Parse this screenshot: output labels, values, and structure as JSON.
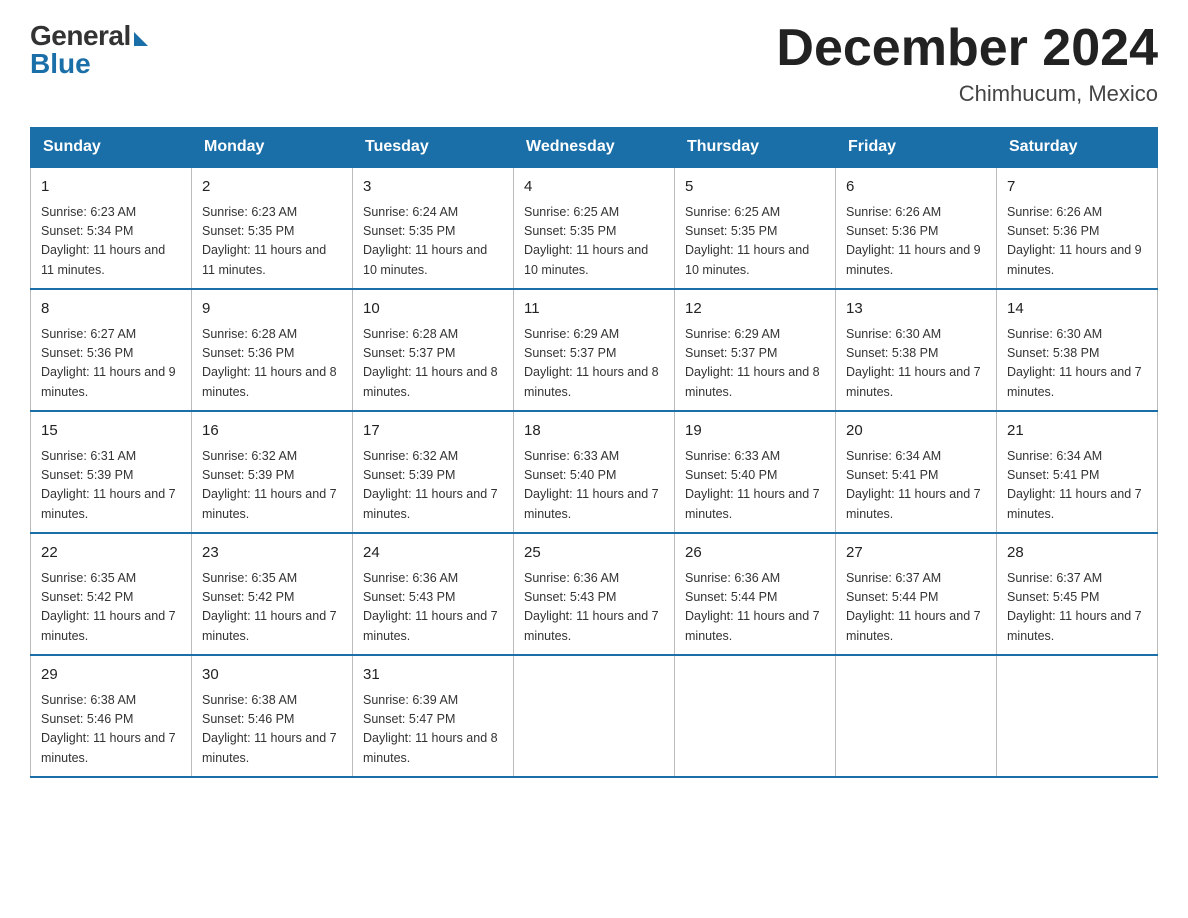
{
  "logo": {
    "general": "General",
    "blue": "Blue"
  },
  "title": {
    "month_year": "December 2024",
    "location": "Chimhucum, Mexico"
  },
  "calendar": {
    "headers": [
      "Sunday",
      "Monday",
      "Tuesday",
      "Wednesday",
      "Thursday",
      "Friday",
      "Saturday"
    ],
    "weeks": [
      [
        {
          "day": "1",
          "sunrise": "6:23 AM",
          "sunset": "5:34 PM",
          "daylight": "11 hours and 11 minutes."
        },
        {
          "day": "2",
          "sunrise": "6:23 AM",
          "sunset": "5:35 PM",
          "daylight": "11 hours and 11 minutes."
        },
        {
          "day": "3",
          "sunrise": "6:24 AM",
          "sunset": "5:35 PM",
          "daylight": "11 hours and 10 minutes."
        },
        {
          "day": "4",
          "sunrise": "6:25 AM",
          "sunset": "5:35 PM",
          "daylight": "11 hours and 10 minutes."
        },
        {
          "day": "5",
          "sunrise": "6:25 AM",
          "sunset": "5:35 PM",
          "daylight": "11 hours and 10 minutes."
        },
        {
          "day": "6",
          "sunrise": "6:26 AM",
          "sunset": "5:36 PM",
          "daylight": "11 hours and 9 minutes."
        },
        {
          "day": "7",
          "sunrise": "6:26 AM",
          "sunset": "5:36 PM",
          "daylight": "11 hours and 9 minutes."
        }
      ],
      [
        {
          "day": "8",
          "sunrise": "6:27 AM",
          "sunset": "5:36 PM",
          "daylight": "11 hours and 9 minutes."
        },
        {
          "day": "9",
          "sunrise": "6:28 AM",
          "sunset": "5:36 PM",
          "daylight": "11 hours and 8 minutes."
        },
        {
          "day": "10",
          "sunrise": "6:28 AM",
          "sunset": "5:37 PM",
          "daylight": "11 hours and 8 minutes."
        },
        {
          "day": "11",
          "sunrise": "6:29 AM",
          "sunset": "5:37 PM",
          "daylight": "11 hours and 8 minutes."
        },
        {
          "day": "12",
          "sunrise": "6:29 AM",
          "sunset": "5:37 PM",
          "daylight": "11 hours and 8 minutes."
        },
        {
          "day": "13",
          "sunrise": "6:30 AM",
          "sunset": "5:38 PM",
          "daylight": "11 hours and 7 minutes."
        },
        {
          "day": "14",
          "sunrise": "6:30 AM",
          "sunset": "5:38 PM",
          "daylight": "11 hours and 7 minutes."
        }
      ],
      [
        {
          "day": "15",
          "sunrise": "6:31 AM",
          "sunset": "5:39 PM",
          "daylight": "11 hours and 7 minutes."
        },
        {
          "day": "16",
          "sunrise": "6:32 AM",
          "sunset": "5:39 PM",
          "daylight": "11 hours and 7 minutes."
        },
        {
          "day": "17",
          "sunrise": "6:32 AM",
          "sunset": "5:39 PM",
          "daylight": "11 hours and 7 minutes."
        },
        {
          "day": "18",
          "sunrise": "6:33 AM",
          "sunset": "5:40 PM",
          "daylight": "11 hours and 7 minutes."
        },
        {
          "day": "19",
          "sunrise": "6:33 AM",
          "sunset": "5:40 PM",
          "daylight": "11 hours and 7 minutes."
        },
        {
          "day": "20",
          "sunrise": "6:34 AM",
          "sunset": "5:41 PM",
          "daylight": "11 hours and 7 minutes."
        },
        {
          "day": "21",
          "sunrise": "6:34 AM",
          "sunset": "5:41 PM",
          "daylight": "11 hours and 7 minutes."
        }
      ],
      [
        {
          "day": "22",
          "sunrise": "6:35 AM",
          "sunset": "5:42 PM",
          "daylight": "11 hours and 7 minutes."
        },
        {
          "day": "23",
          "sunrise": "6:35 AM",
          "sunset": "5:42 PM",
          "daylight": "11 hours and 7 minutes."
        },
        {
          "day": "24",
          "sunrise": "6:36 AM",
          "sunset": "5:43 PM",
          "daylight": "11 hours and 7 minutes."
        },
        {
          "day": "25",
          "sunrise": "6:36 AM",
          "sunset": "5:43 PM",
          "daylight": "11 hours and 7 minutes."
        },
        {
          "day": "26",
          "sunrise": "6:36 AM",
          "sunset": "5:44 PM",
          "daylight": "11 hours and 7 minutes."
        },
        {
          "day": "27",
          "sunrise": "6:37 AM",
          "sunset": "5:44 PM",
          "daylight": "11 hours and 7 minutes."
        },
        {
          "day": "28",
          "sunrise": "6:37 AM",
          "sunset": "5:45 PM",
          "daylight": "11 hours and 7 minutes."
        }
      ],
      [
        {
          "day": "29",
          "sunrise": "6:38 AM",
          "sunset": "5:46 PM",
          "daylight": "11 hours and 7 minutes."
        },
        {
          "day": "30",
          "sunrise": "6:38 AM",
          "sunset": "5:46 PM",
          "daylight": "11 hours and 7 minutes."
        },
        {
          "day": "31",
          "sunrise": "6:39 AM",
          "sunset": "5:47 PM",
          "daylight": "11 hours and 8 minutes."
        },
        null,
        null,
        null,
        null
      ]
    ]
  }
}
